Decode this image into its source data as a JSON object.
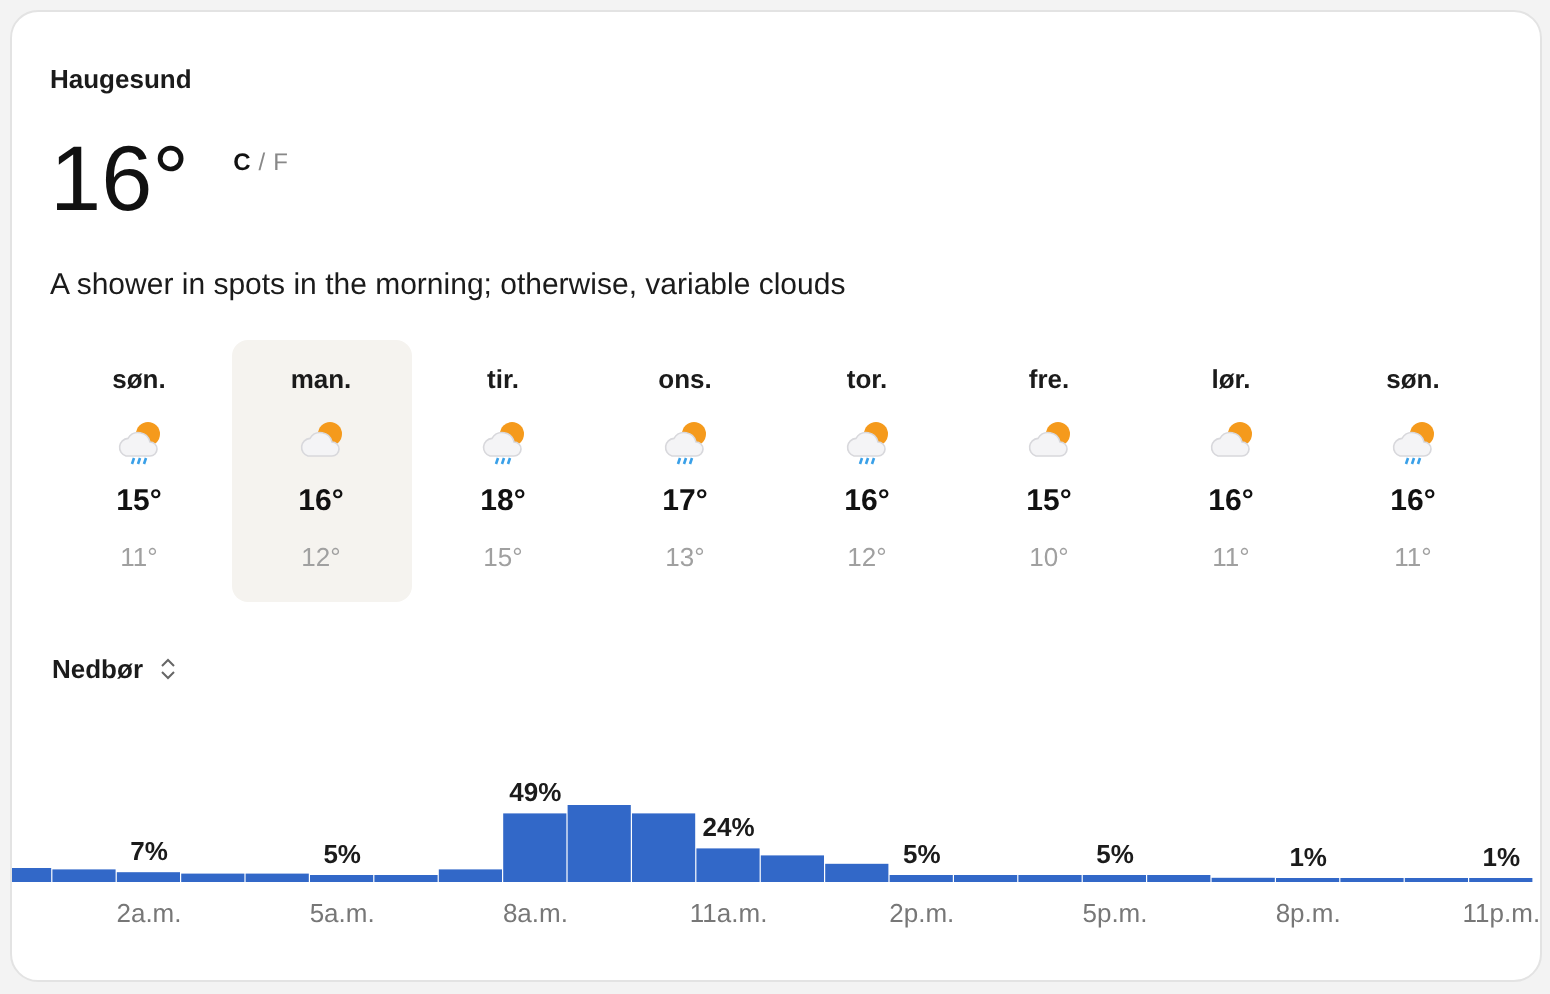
{
  "location": "Haugesund",
  "current": {
    "temperature": "16°",
    "units": [
      {
        "label": "C",
        "selected": true
      },
      {
        "label": "F",
        "selected": false
      }
    ],
    "separator": "/"
  },
  "summary": "A shower in spots in the morning; otherwise, variable clouds",
  "days": [
    {
      "day": "søn.",
      "kind": "rain",
      "high": "15°",
      "low": "11°",
      "selected": false
    },
    {
      "day": "man.",
      "kind": "partly-cloudy",
      "high": "16°",
      "low": "12°",
      "selected": true
    },
    {
      "day": "tir.",
      "kind": "rain",
      "high": "18°",
      "low": "15°",
      "selected": false
    },
    {
      "day": "ons.",
      "kind": "rain",
      "high": "17°",
      "low": "13°",
      "selected": false
    },
    {
      "day": "tor.",
      "kind": "rain",
      "high": "16°",
      "low": "12°",
      "selected": false
    },
    {
      "day": "fre.",
      "kind": "partly-cloudy",
      "high": "15°",
      "low": "10°",
      "selected": false
    },
    {
      "day": "lør.",
      "kind": "partly-cloudy",
      "high": "16°",
      "low": "11°",
      "selected": false
    },
    {
      "day": "søn.",
      "kind": "rain",
      "high": "16°",
      "low": "11°",
      "selected": false
    }
  ],
  "metric_selector": {
    "label": "Nedbør"
  },
  "chart_data": {
    "type": "bar",
    "color": "#3268c8",
    "values": [
      10,
      9,
      7,
      6,
      6,
      5,
      5,
      9,
      49,
      55,
      49,
      24,
      19,
      13,
      5,
      5,
      5,
      5,
      5,
      3,
      1,
      1,
      1,
      1
    ],
    "categories": [
      null,
      null,
      "2a.m.",
      null,
      null,
      "5a.m.",
      null,
      null,
      "8a.m.",
      null,
      null,
      "11a.m.",
      null,
      null,
      "2p.m.",
      null,
      null,
      "5p.m.",
      null,
      null,
      "8p.m.",
      null,
      null,
      "11p.m."
    ],
    "value_labels": [
      null,
      null,
      "7%",
      null,
      null,
      "5%",
      null,
      null,
      "49%",
      null,
      null,
      "24%",
      null,
      null,
      "5%",
      null,
      null,
      "5%",
      null,
      null,
      "1%",
      null,
      null,
      "1%"
    ]
  }
}
